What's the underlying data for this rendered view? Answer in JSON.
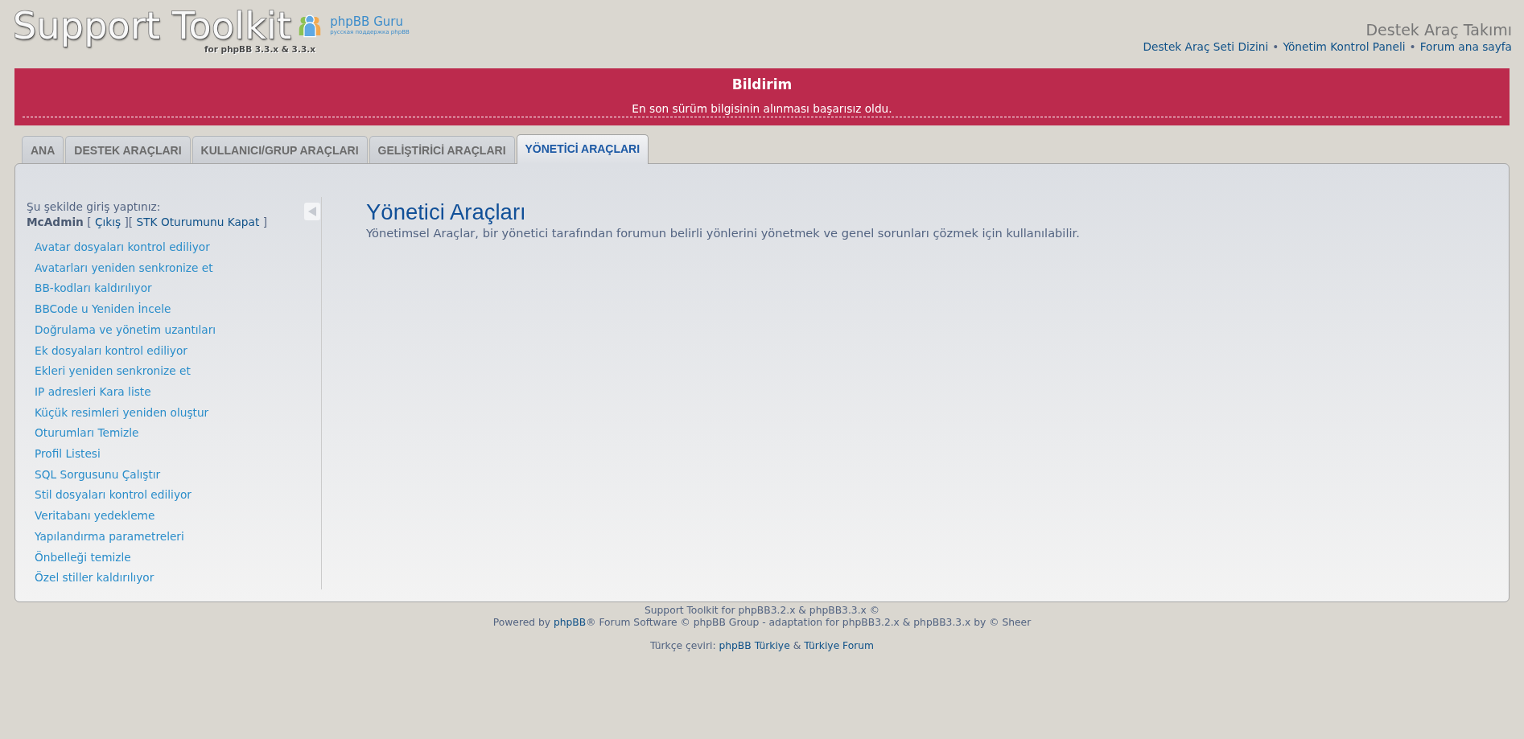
{
  "header": {
    "logo": {
      "title": "Support Toolkit",
      "subtitle": "for phpBB 3.3.x & 3.3.x",
      "partner_name": "phpBB Guru",
      "partner_tagline": "русская поддержка phpBB"
    },
    "site_title": "Destek Araç Takımı",
    "nav": [
      {
        "kind": "link",
        "text": "Destek Araç Seti Dizini"
      },
      {
        "kind": "separator",
        "text": "•"
      },
      {
        "kind": "link",
        "text": "Yönetim Kontrol Paneli"
      },
      {
        "kind": "separator",
        "text": "•"
      },
      {
        "kind": "link",
        "text": "Forum ana sayfa"
      }
    ]
  },
  "notice": {
    "title": "Bildirim",
    "message": "En son sürüm bilgisinin alınması başarısız oldu."
  },
  "tabs": [
    {
      "label": "ANA",
      "selected": false
    },
    {
      "label": "DESTEK ARAÇLARI",
      "selected": false
    },
    {
      "label": "KULLANICI/GRUP ARAÇLARI",
      "selected": false
    },
    {
      "label": "GELİŞTİRİCİ ARAÇLARI",
      "selected": false
    },
    {
      "label": "YÖNETİCİ ARAÇLARI",
      "selected": true
    }
  ],
  "sidebar": {
    "login_label": "Şu şekilde giriş yaptınız:",
    "login_status": [
      {
        "kind": "username",
        "text": "McAdmin"
      },
      {
        "kind": "text",
        "text": " [ "
      },
      {
        "kind": "link",
        "text": "Çıkış"
      },
      {
        "kind": "text",
        "text": " ][ "
      },
      {
        "kind": "link",
        "text": "STK Oturumunu Kapat"
      },
      {
        "kind": "text",
        "text": " ]"
      }
    ],
    "menu": [
      "Avatar dosyaları kontrol ediliyor",
      "Avatarları yeniden senkronize et",
      "BB-kodları kaldırılıyor",
      "BBCode u Yeniden İncele",
      "Doğrulama ve yönetim uzantıları",
      "Ek dosyaları kontrol ediliyor",
      "Ekleri yeniden senkronize et",
      "IP adresleri Kara liste",
      "Küçük resimleri yeniden oluştur",
      "Oturumları Temizle",
      "Profil Listesi",
      "SQL Sorgusunu Çalıştır",
      "Stil dosyaları kontrol ediliyor",
      "Veritabanı yedekleme",
      "Yapılandırma parametreleri",
      "Önbelleği temizle",
      "Özel stiller kaldırılıyor"
    ]
  },
  "content": {
    "title": "Yönetici Araçları",
    "description": "Yönetimsel Araçlar, bir yönetici tarafından forumun belirli yönlerini yönetmek ve genel sorunları çözmek için kullanılabilir."
  },
  "footer": {
    "credits": [
      [
        {
          "kind": "text",
          "text": "Support Toolkit for phpBB3.2.x & phpBB3.3.x ©"
        }
      ],
      [
        {
          "kind": "text",
          "text": "Powered by "
        },
        {
          "kind": "link",
          "text": "phpBB"
        },
        {
          "kind": "text",
          "text": "® Forum Software © phpBB Group - adaptation for phpBB3.2.x & phpBB3.3.x by © Sheer"
        }
      ]
    ],
    "translation": [
      {
        "kind": "text",
        "text": "Türkçe çeviri: "
      },
      {
        "kind": "link",
        "text": "phpBB Türkiye"
      },
      {
        "kind": "text",
        "text": " & "
      },
      {
        "kind": "link",
        "text": "Türkiye Forum"
      }
    ]
  }
}
